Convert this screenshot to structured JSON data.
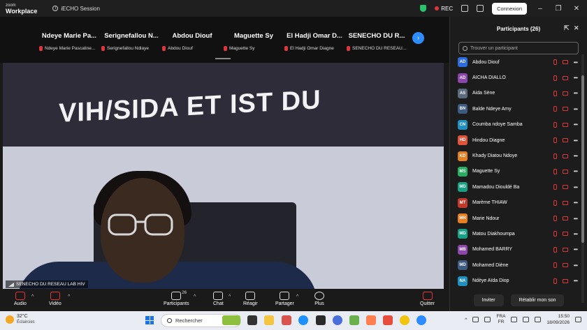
{
  "titlebar": {
    "logo_line1": "zoom",
    "logo_line2": "Workplace",
    "session": "iECHO Session",
    "rec": "REC",
    "connexion": "Connexion"
  },
  "gallery": [
    {
      "name": "Ndeye Marie Pa...",
      "label": "Ndeye Marie Pascaline..."
    },
    {
      "name": "Serignefallou N...",
      "label": "Serignefallou Ndiaye"
    },
    {
      "name": "Abdou Diouf",
      "label": "Abdou Diouf"
    },
    {
      "name": "Maguette Sy",
      "label": "Maguette Sy"
    },
    {
      "name": "El Hadji Omar D...",
      "label": "El Hadji Omar Diagne"
    },
    {
      "name": "SENECHO DU R...",
      "label": "SENECHO DU RESEAU..."
    }
  ],
  "video": {
    "banner_text": "VIH/SIDA ET IST DU",
    "speaker": "SENECHO DU RESEAU LAB HIV"
  },
  "panel": {
    "title": "Participants (26)",
    "search_placeholder": "Trouver un participant",
    "invite": "Inviter",
    "restore_sound": "Rétablir mon son",
    "participants": [
      {
        "initials": "AD",
        "name": "Abdou Diouf",
        "color": "#2d6cdf"
      },
      {
        "initials": "AD",
        "name": "AICHA DIALLO",
        "color": "#8e44ad"
      },
      {
        "initials": "AS",
        "name": "Aida Sène",
        "color": "#5a6b7d"
      },
      {
        "initials": "BN",
        "name": "Balde Ndeye Amy",
        "color": "#3d5a80"
      },
      {
        "initials": "CN",
        "name": "Coumba ndoye Samba",
        "color": "#1f8fbf"
      },
      {
        "initials": "HD",
        "name": "Hindou Diagne",
        "color": "#e0533b"
      },
      {
        "initials": "KD",
        "name": "Khady Diatou Ndoye",
        "color": "#e67e22"
      },
      {
        "initials": "MS",
        "name": "Maguette Sy",
        "color": "#27ae60"
      },
      {
        "initials": "MD",
        "name": "Mamadou Diouldé Ba",
        "color": "#16a085"
      },
      {
        "initials": "MT",
        "name": "Marème THIAW",
        "color": "#c0392b"
      },
      {
        "initials": "MN",
        "name": "Marie Ndour",
        "color": "#e67e22"
      },
      {
        "initials": "MD",
        "name": "Matou Diakhoumpa",
        "color": "#16a085"
      },
      {
        "initials": "MB",
        "name": "Mohamed BARRY",
        "color": "#8e44ad"
      },
      {
        "initials": "MD",
        "name": "Mohamed Diène",
        "color": "#3d5a80"
      },
      {
        "initials": "NA",
        "name": "Ndèye Aïda Diop",
        "color": "#1f8fbf"
      }
    ]
  },
  "toolbar": {
    "audio": "Audio",
    "video": "Vidéo",
    "participants": "Participants",
    "participants_count": "26",
    "chat": "Chat",
    "react": "Réagir",
    "share": "Partager",
    "more": "Plus",
    "quit": "Quitter"
  },
  "taskbar": {
    "temperature": "32°C",
    "weather": "Éclaircies",
    "search": "Rechercher",
    "lang1": "FRA",
    "lang2": "FR",
    "time": "15:50",
    "date": "18/09/2026"
  }
}
